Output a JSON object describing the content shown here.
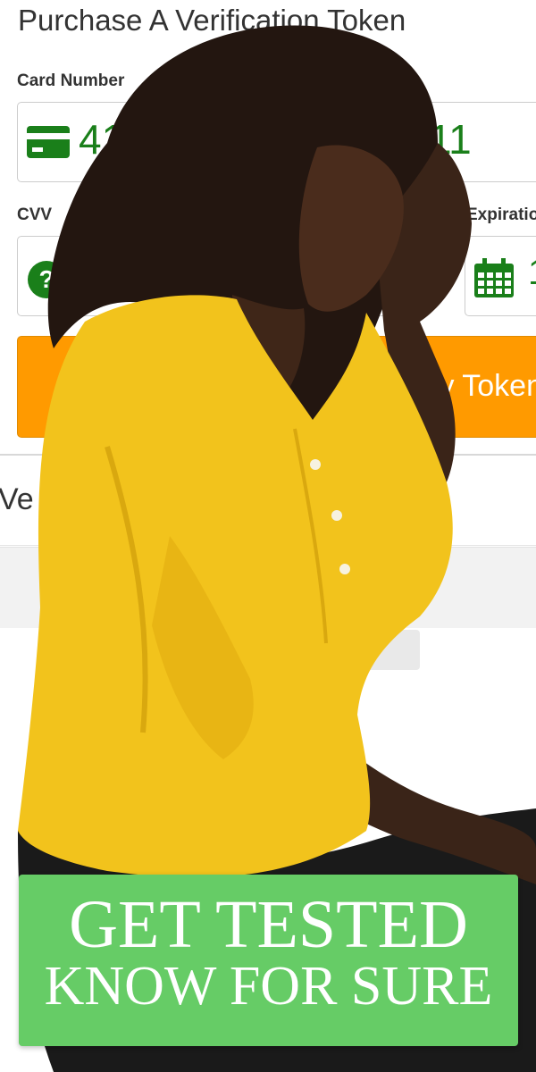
{
  "form": {
    "title": "Purchase A Verification Token",
    "card_number_label": "Card Number",
    "card_number_value_left": "411",
    "card_number_value_right": "11",
    "cvv_label": "CVV",
    "expiration_label": "Expiration",
    "expiration_value_partial": "1",
    "purchase_button_label": "y Token",
    "verify_section_partial": "Ve"
  },
  "banner": {
    "line1": "GET TESTED",
    "line2": "KNOW FOR SURE"
  },
  "colors": {
    "accent_green": "#1a7f1a",
    "button_orange": "#ff9a00",
    "banner_green": "#66cc66",
    "shirt_yellow": "#f2c31c"
  },
  "icons": {
    "card": "credit-card-icon",
    "cvv": "question-circle-icon",
    "expiration": "calendar-icon"
  }
}
